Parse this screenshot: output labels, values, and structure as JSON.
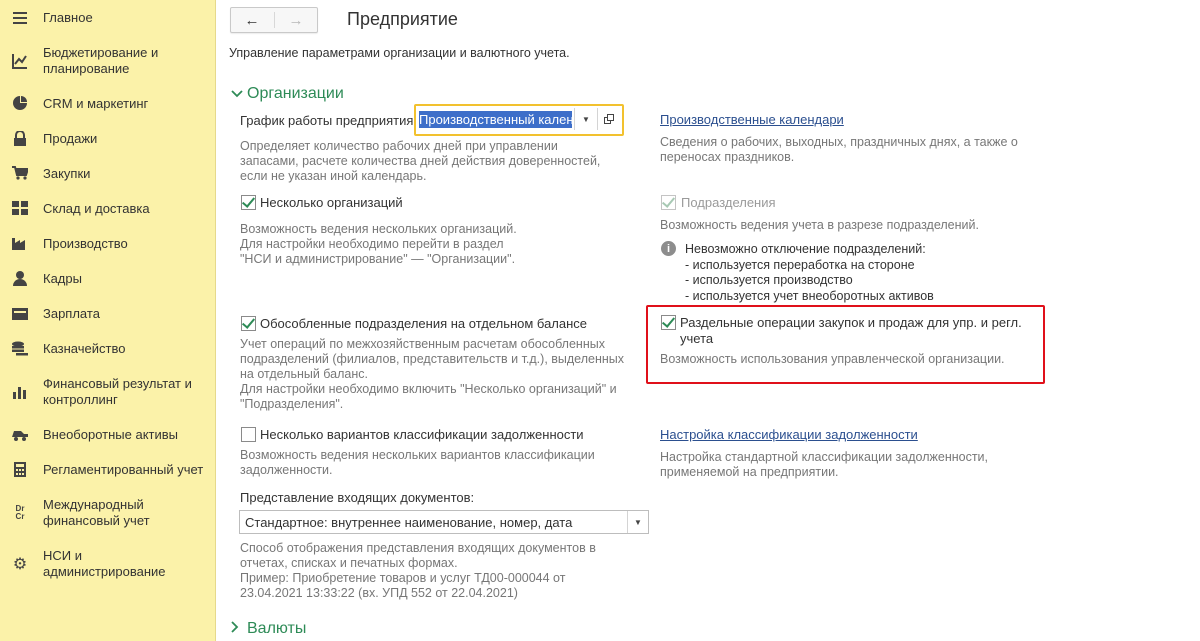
{
  "sidebar": {
    "items": [
      {
        "label": "Главное",
        "icon": "menu-icon"
      },
      {
        "label": "Бюджетирование и планирование",
        "icon": "chart-icon"
      },
      {
        "label": "CRM и маркетинг",
        "icon": "pie-icon"
      },
      {
        "label": "Продажи",
        "icon": "lock-icon"
      },
      {
        "label": "Закупки",
        "icon": "cart-icon"
      },
      {
        "label": "Склад и доставка",
        "icon": "warehouse-icon"
      },
      {
        "label": "Производство",
        "icon": "factory-icon"
      },
      {
        "label": "Кадры",
        "icon": "person-icon"
      },
      {
        "label": "Зарплата",
        "icon": "wallet-icon"
      },
      {
        "label": "Казначейство",
        "icon": "coins-icon"
      },
      {
        "label": "Финансовый результат и контроллинг",
        "icon": "bar-chart-icon"
      },
      {
        "label": "Внеоборотные активы",
        "icon": "truck-icon"
      },
      {
        "label": "Регламентированный учет",
        "icon": "calculator-icon"
      },
      {
        "label": "Международный финансовый учет",
        "icon": "dr-cr-icon"
      },
      {
        "label": "НСИ и администрирование",
        "icon": "gear-icon"
      }
    ]
  },
  "header": {
    "back": "←",
    "forward": "→",
    "title": "Предприятие",
    "subtitle": "Управление параметрами организации и валютного учета."
  },
  "sections": {
    "organizations": "Организации",
    "currencies": "Валюты"
  },
  "left": {
    "schedule_label": "График работы предприятия:",
    "schedule_value": "Производственный кален",
    "schedule_hint": [
      "Определяет количество рабочих дней при управлении",
      "запасами, расчете количества дней действия доверенностей,",
      "если не указан иной календарь."
    ],
    "multi_org_label": "Несколько организаций",
    "multi_org_checked": true,
    "multi_org_hint": [
      "Возможность ведения нескольких организаций.",
      "Для настройки необходимо перейти в раздел",
      "\"НСИ и администрирование\" — \"Организации\"."
    ],
    "separate_label": "Обособленные подразделения на отдельном балансе",
    "separate_checked": true,
    "separate_hint": [
      "Учет операций по межхозяйственным расчетам обособленных",
      "подразделений (филиалов, представительств и т.д.), выделенных",
      "на отдельный баланс.",
      "Для настройки необходимо включить \"Несколько организаций\" и",
      "\"Подразделения\"."
    ],
    "debt_variants_label": "Несколько вариантов классификации задолженности",
    "debt_variants_checked": false,
    "debt_variants_hint": [
      "Возможность ведения нескольких вариантов классификации",
      "задолженности."
    ],
    "incoming_label": "Представление входящих документов:",
    "incoming_value": "Стандартное: внутреннее наименование, номер, дата",
    "incoming_hint": [
      "Способ отображения представления входящих документов в",
      "отчетах, списках и печатных формах.",
      "Пример: Приобретение товаров и услуг ТД00-000044 от",
      "23.04.2021 13:33:22 (вх. УПД 552 от 22.04.2021)"
    ]
  },
  "right": {
    "calendars_link": "Производственные календари",
    "calendars_hint": [
      "Сведения о рабочих, выходных, праздничных днях, а также о",
      "переносах праздников."
    ],
    "departments_label": "Подразделения",
    "departments_checked": true,
    "departments_hint": "Возможность ведения учета в разрезе подразделений.",
    "info_lines": [
      "Невозможно отключение подразделений:",
      "- используется переработка на стороне",
      "- используется производство",
      "- используется учет внеоборотных активов"
    ],
    "separate_ops_label": [
      "Раздельные операции закупок и продаж для упр. и регл.",
      "учета"
    ],
    "separate_ops_checked": true,
    "separate_ops_hint": "Возможность использования управленческой организации.",
    "debt_link": "Настройка классификации задолженности",
    "debt_hint": [
      "Настройка стандартной классификации задолженности,",
      "применяемой на предприятии."
    ]
  },
  "colors": {
    "sidebar_bg": "#fbf2a9",
    "accent_green": "#2e8b57",
    "highlight_red": "#e0101a",
    "focus_yellow": "#f2c12e",
    "selection_blue": "#3d6ec9"
  }
}
